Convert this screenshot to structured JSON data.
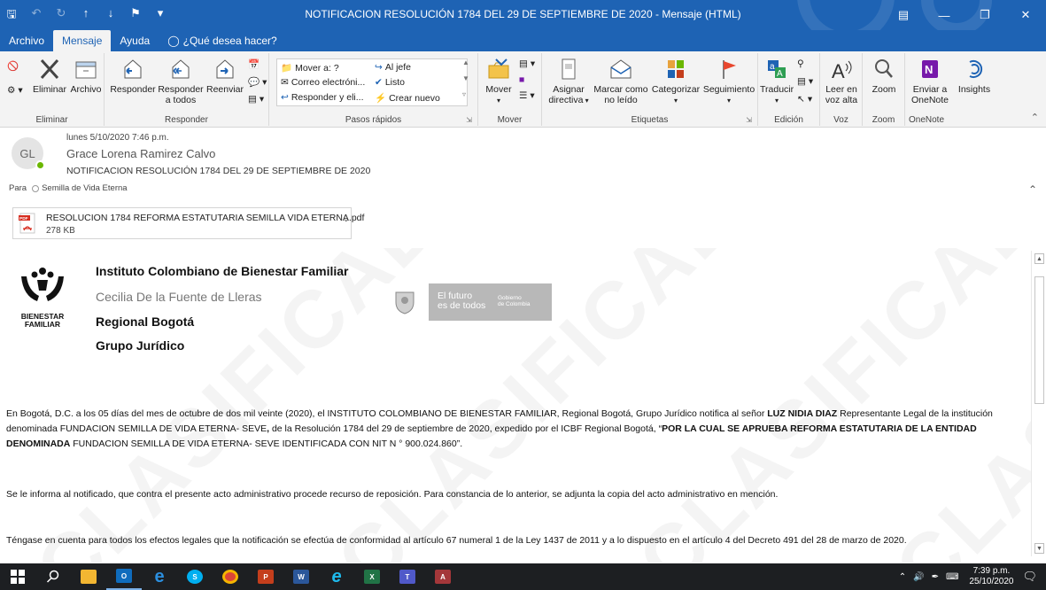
{
  "window": {
    "title": "NOTIFICACION RESOLUCIÓN 1784 DEL 29 DE SEPTIEMBRE DE 2020  -  Mensaje (HTML)"
  },
  "tabs": [
    {
      "label": "Archivo"
    },
    {
      "label": "Mensaje",
      "active": true
    },
    {
      "label": "Ayuda"
    },
    {
      "label": "¿Qué desea hacer?"
    }
  ],
  "ribbon": {
    "eliminar": {
      "label": "Eliminar",
      "eliminar_btn": "Eliminar",
      "archivo_btn": "Archivo"
    },
    "responder": {
      "label": "Responder",
      "reply": "Responder",
      "reply_all_line1": "Responder",
      "reply_all_line2": "a todos",
      "forward": "Reenviar"
    },
    "pasos_rapidos": {
      "label": "Pasos rápidos",
      "items": [
        "Mover a: ?",
        "Correo electróni...",
        "Responder y eli...",
        "Al jefe",
        "Listo",
        "Crear nuevo"
      ]
    },
    "mover": {
      "label": "Mover",
      "move": "Mover"
    },
    "etiquetas": {
      "label": "Etiquetas",
      "assign_line1": "Asignar",
      "assign_line2": "directiva",
      "mark_line1": "Marcar como",
      "mark_line2": "no leído",
      "categorize": "Categorizar",
      "followup": "Seguimiento"
    },
    "edicion": {
      "label": "Edición",
      "translate": "Traducir"
    },
    "voz": {
      "label": "Voz",
      "read_line1": "Leer en",
      "read_line2": "voz alta"
    },
    "zoom": {
      "label": "Zoom",
      "zoom": "Zoom"
    },
    "onenote": {
      "label": "OneNote",
      "send_line1": "Enviar a",
      "send_line2": "OneNote",
      "insights": "Insights"
    }
  },
  "message": {
    "avatar_initials": "GL",
    "date": "lunes 5/10/2020 7:46 p.m.",
    "sender": "Grace Lorena Ramirez Calvo",
    "subject": "NOTIFICACION RESOLUCIÓN 1784 DEL 29 DE SEPTIEMBRE DE 2020",
    "to_label": "Para",
    "to_value": "Semilla de Vida Eterna"
  },
  "attachment": {
    "name": "RESOLUCION 1784 REFORMA ESTATUTARIA SEMILLA VIDA ETERNA.pdf",
    "size": "278 KB",
    "type_badge": "PDF"
  },
  "body": {
    "watermark": "CLASIFICADA",
    "logo_label_line1": "BIENESTAR",
    "logo_label_line2": "FAMILIAR",
    "institute": "Instituto Colombiano de Bienestar Familiar",
    "director": "Cecilia De la Fuente de Lleras",
    "regional": "Regional Bogotá",
    "group": "Grupo Jurídico",
    "gov_line1": "El futuro",
    "gov_line2": "es de todos",
    "gov_small1": "Gobierno",
    "gov_small2": "de Colombia",
    "p1_a": "En Bogotá, D.C. a los 05 días del mes de octubre de dos mil veinte (2020), el INSTITUTO COLOMBIANO DE BIENESTAR FAMILIAR, Regional Bogotá, Grupo Jurídico notifica al señor ",
    "p1_b": "LUZ NIDIA DIAZ",
    "p1_c": " Representante Legal de la institución denominada FUNDACION SEMILLA DE VIDA ETERNA- SEVE",
    "p1_d": ",",
    "p1_e": " de la Resolución 1784 del 29 de septiembre de 2020, expedido por el ICBF Regional Bogotá, “",
    "p1_f": "POR LA CUAL SE  APRUEBA REFORMA ESTATUTARIA DE LA ENTIDAD DENOMINADA",
    "p1_g": " FUNDACION SEMILLA DE VIDA ETERNA- SEVE IDENTIFICADA CON NIT N ° 900.024.860”.",
    "p2": "Se le informa al notificado, que contra el presente acto administrativo procede recurso de reposición. Para constancia de lo anterior, se adjunta la copia del acto administrativo en mención.",
    "p3": "Téngase en cuenta para todos los efectos legales que la notificación se efectúa de conformidad al artículo 67 numeral 1 de la Ley 1437 de 2011 y a lo dispuesto en el artículo 4 del Decreto 491 del 28 de marzo de 2020."
  },
  "taskbar": {
    "time": "7:39 p.m.",
    "date": "25/10/2020"
  },
  "colors": {
    "accent": "#1e63b4",
    "taskbar": "#1d1f22",
    "ribbon": "#f3f3f3"
  }
}
